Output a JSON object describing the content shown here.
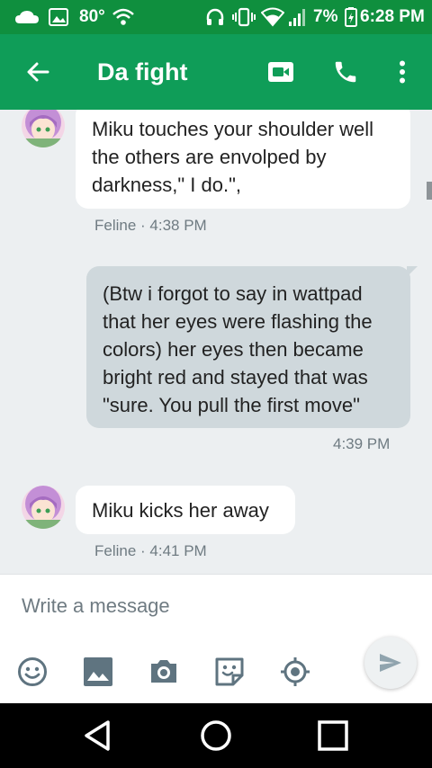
{
  "status_bar": {
    "temperature": "80°",
    "battery_percent": "7%",
    "time": "6:28 PM"
  },
  "header": {
    "title": "Da fight"
  },
  "messages": [
    {
      "direction": "incoming",
      "text": "Miku touches your shoulder well the others are envolped by darkness,\" I do.\",",
      "meta": "Feline · 4:38 PM"
    },
    {
      "direction": "outgoing",
      "text": "(Btw i forgot to say in wattpad that her eyes were flashing the colors) her eyes then became bright red and stayed that was \"sure. You pull the first move\"",
      "meta": "4:39 PM"
    },
    {
      "direction": "incoming",
      "text": "Miku kicks her away",
      "meta": "Feline · 4:41 PM"
    }
  ],
  "composer": {
    "placeholder": "Write a message"
  },
  "icons": {
    "header": [
      "back-arrow-icon",
      "video-call-icon",
      "phone-icon",
      "more-vert-icon"
    ],
    "composer": [
      "emoji-icon",
      "image-icon",
      "camera-icon",
      "sticker-icon",
      "location-icon",
      "send-icon"
    ],
    "nav": [
      "nav-back-icon",
      "nav-home-icon",
      "nav-recents-icon"
    ]
  },
  "colors": {
    "app_bar": "#0f9d58",
    "status_bar": "#0f8f3e",
    "chat_background": "#eceff1",
    "incoming_bubble": "#ffffff",
    "outgoing_bubble": "#cfd8dc",
    "meta_text": "#6f7b82"
  }
}
